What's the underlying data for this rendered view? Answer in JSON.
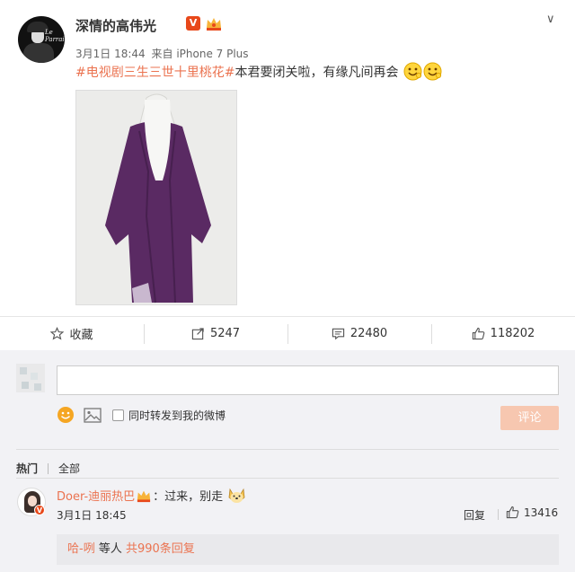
{
  "post": {
    "username": "深情的高伟光",
    "verified_badge": "V",
    "date": "3月1日 18:44",
    "source": "来自 iPhone 7 Plus",
    "hashtag": "#电视剧三生三世十里桃花#",
    "text": "本君要闭关啦，有缘凡间再会",
    "avatar_logo": "Le Parrain",
    "menu_icon": "chevron-down-icon"
  },
  "actions": {
    "favorite_label": "收藏",
    "forward_count": "5247",
    "comment_count": "22480",
    "like_count": "118202"
  },
  "comment_form": {
    "placeholder": "",
    "forward_label": "同时转发到我的微博",
    "submit_label": "评论"
  },
  "tabs": {
    "hot": "热门",
    "all": "全部"
  },
  "comment": {
    "author": "Doer-迪丽热巴",
    "text": "：过来，别走",
    "date": "3月1日 18:45",
    "reply_label": "回复",
    "like_count": "13416",
    "reply_summary_user": "哈-咧",
    "reply_summary_mid": " 等人 ",
    "reply_summary_count": "共990条回复"
  },
  "colors": {
    "link": "#eb7350",
    "badge": "#e8481a",
    "submit_disabled": "#f7c7b0",
    "comment_bg": "#f2f2f5"
  }
}
